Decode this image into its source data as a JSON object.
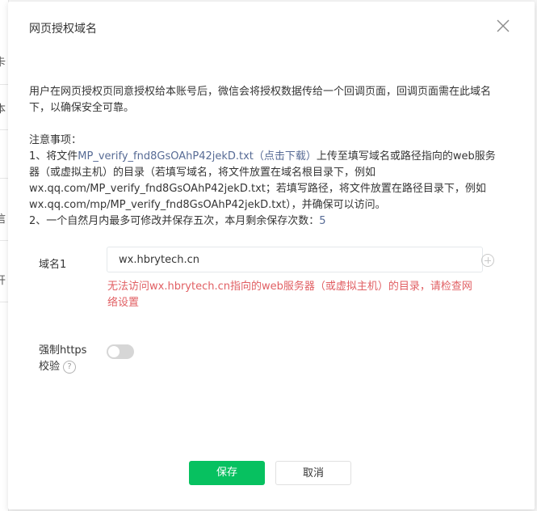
{
  "background": {
    "fragments": [
      "卡",
      "本",
      "信",
      "开"
    ]
  },
  "dialog": {
    "title": "网页授权域名",
    "close_icon": "close-icon",
    "description": "用户在网页授权页同意授权给本账号后，微信会将授权数据传给一个回调页面，回调页面需在此域名下，以确保安全可靠。",
    "notes_title": "注意事项：",
    "note1_prefix": "1、将文件",
    "note1_link": "MP_verify_fnd8GsOAhP42jekD.txt（点击下载）",
    "note1_suffix": "上传至填写域名或路径指向的web服务器（或虚拟主机）的目录（若填写域名，将文件放置在域名根目录下，例如wx.qq.com/MP_verify_fnd8GsOAhP42jekD.txt；若填写路径，将文件放置在路径目录下，例如wx.qq.com/mp/MP_verify_fnd8GsOAhP42jekD.txt），并确保可以访问。",
    "note2_prefix": "2、一个自然月内最多可修改并保存五次，本月剩余保存次数：",
    "note2_count": "5",
    "domain_label": "域名1",
    "domain_value": "wx.hbrytech.cn",
    "add_icon": "add-circle-icon",
    "error_message": "无法访问wx.hbrytech.cn指向的web服务器（或虚拟主机）的目录，请检查网络设置",
    "https_label_line1": "强制https",
    "https_label_line2": "校验",
    "help_icon_glyph": "?",
    "https_enabled": false,
    "save_label": "保存",
    "cancel_label": "取消"
  },
  "colors": {
    "primary": "#07c160",
    "link": "#576b95",
    "error": "#e15f63"
  }
}
